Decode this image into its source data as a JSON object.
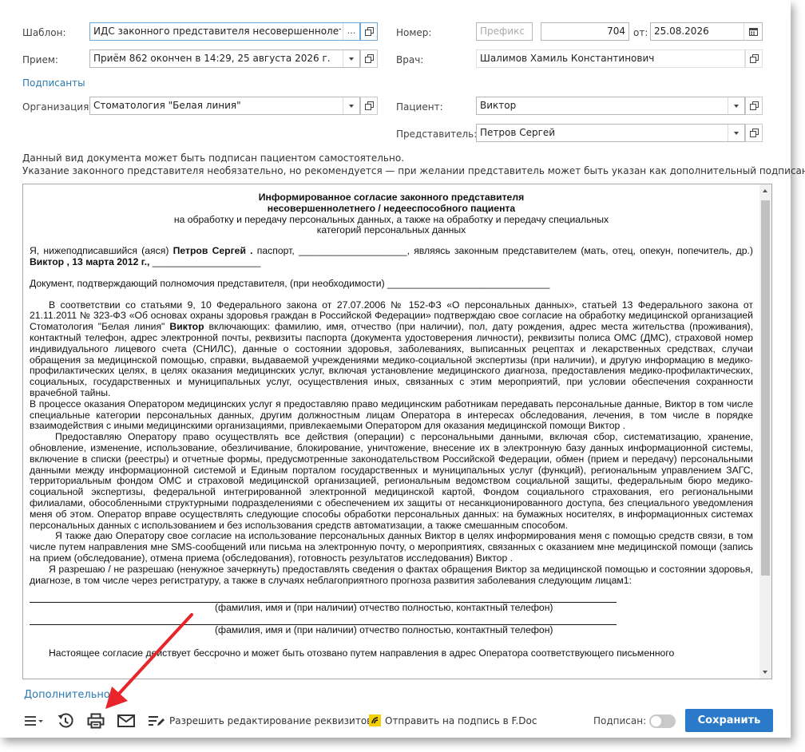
{
  "form": {
    "template_label": "Шаблон:",
    "template_value": "ИДС законного представителя несовершеннолетнег",
    "template_dots": "...",
    "number_label": "Номер:",
    "number_prefix_placeholder": "Префикс",
    "number_value": "704",
    "date_label": "от:",
    "date_value": "25.08.2026",
    "appointment_label": "Прием:",
    "appointment_value": "Приём 862 окончен в 14:29, 25 августа 2026 г.",
    "doctor_label": "Врач:",
    "doctor_value": "Шалимов Хамиль Константинович",
    "signers_link": "Подписанты",
    "organization_label": "Организация:",
    "organization_value": "Стоматология \"Белая линия\"",
    "patient_label": "Пациент:",
    "patient_value": "Виктор",
    "representative_label": "Представитель:",
    "representative_value": "Петров Сергей"
  },
  "info": {
    "line1": "Данный вид документа может быть подписан пациентом самостоятельно.",
    "line2": "Указание законного представителя необязательно, но рекомендуется — при желании представитель может быть указан как дополнительный подписант."
  },
  "document": {
    "title1": "Информированное согласие законного представителя",
    "title2": "несовершеннолетнего / недееспособного пациента",
    "subtitle1": "на обработку и передачу персональных данных, а также на обработку и передачу специальных",
    "subtitle2": "категорий персональных данных",
    "p1_a": "Я, нижеподписавшийся (аяся) ",
    "p1_name": "Петров Сергей .",
    "p1_b": " паспорт, ____________________, являясь законным представителем (мать, отец, опекун, попечитель, др.) ",
    "p1_patient": " Виктор , 13 марта 2012 г.,",
    "p1_c": " ____________________",
    "p2": "Документ, подтверждающий полномочия представителя, (при необходимости) ______________________________",
    "p3_a": "В соответствии со статьями 9, 10 Федерального закона от 27.07.2006 № 152-ФЗ «О персональных данных», статьей 13 Федерального закона от 21.11.2011 № 323-ФЗ «Об основах охраны здоровья граждан в Российской Федерации» подтверждаю свое согласие на обработку медицинской организацией Стоматология \"Белая линия\"   ",
    "p3_patient": "Виктор",
    "p3_b": "  включающих: фамилию, имя, отчество (при наличии), пол, дату рождения, адрес места жительства (проживания), контактный телефон, адрес электронной почты, реквизиты паспорта (документа удостоверения личности), реквизиты полиса ОМС (ДМС), страховой номер индивидуального лицевого счета (СНИЛС), данные о состоянии здоровья, заболеваниях, выписанных рецептах и лекарственных средствах, случаи обращения за медицинской помощью, справки, выдаваемой учреждениями медико-социальной экспертизы (при наличии), и другую информацию в медико- профилактических целях, в целях оказания медицинских услуг, включая установление медицинского диагноза, предоставления медико-профилактических, социальных, государственных и муниципальных услуг, осуществления иных, связанных с этим мероприятий, при условии обеспечения сохранности врачебной тайны.",
    "p4": "В процессе оказания Оператором медицинских услуг я предоставляю право медицинским работникам передавать персональные данные,  Виктор  в том числе специальные категории персональных данных, другим должностным лицам Оператора в интересах обследования, лечения, в том числе в порядке взаимодействия с иными медицинскими организациями, привлекаемыми Оператором для оказания медицинской помощи  Виктор .",
    "p5": "Предоставляю Оператору право осуществлять все действия (операции) с персональными данными, включая сбор, систематизацию, хранение, обновление, изменение, использование, обезличивание, блокирование, уничтожение, внесение их в электронную базу данных информационной системы, включение в списки (реестры) и отчетные формы, предусмотренные законодательством Российской Федерации, обмен (прием и передачу) персональными данными между информационной системой и Единым порталом государственных и муниципальных услуг (функций), региональным управлением ЗАГС, территориальным фондом ОМС и страховой медицинской организацией, региональным ведомством социальной защиты, федеральным бюро медико-социальной экспертизы, федеральной интегрированной электронной медицинской картой, Фондом социального страхования, его региональными филиалами, обособленными структурными подразделениями с обеспечением их защиты от несанкционированного доступа, без специального уведомления меня об этом. Оператор вправе осуществлять следующие способы обработки персональных данных: на бумажных носителях, в информационных системах персональных данных с использованием и без использования средств автоматизации, а также смешанным способом.",
    "p6": "Я также даю Оператору свое согласие на использование персональных данных  Виктор  в целях информирования меня с помощью средств связи, в том числе путем направления мне SMS-сообщений или письма на электронную почту, о мероприятиях, связанных с оказанием мне медицинской помощи (запись на прием (обследование), отмена приема (обследования), готовность результатов исследования)  Виктор .",
    "p7": "Я разрешаю / не разрешаю (ненужное зачеркнуть) предоставлять сведения о фактах обращения  Виктор  за медицинской помощью и состоянии здоровья, диагнозе, в том числе через регистратуру, а также в случаях неблагоприятного прогноза развития заболевания следующим лицам1:",
    "caption1": "(фамилия, имя и (при наличии) отчество полностью, контактный телефон)",
    "caption2": "(фамилия, имя и (при наличии) отчество полностью, контактный телефон)",
    "p8_partial": "Настоящее согласие действует бессрочно и может быть отозвано путем направления в адрес Оператора соответствующего письменного"
  },
  "more_link": "Дополнительно",
  "toolbar": {
    "allow_edit_label": "Разрешить редактирование реквизитов",
    "send_fdoc_label": "Отправить на подпись в F.Doc",
    "signed_label": "Подписан:",
    "signed": false,
    "save_label": "Сохранить"
  },
  "colors": {
    "accent": "#2b7ac9",
    "link": "#2a7ab0",
    "fdoc_logo_bg": "#f5d000",
    "annotation_arrow": "#e8252a"
  },
  "icons": [
    "menu-icon",
    "history-icon",
    "print-icon",
    "mail-icon",
    "edit-list-icon",
    "fdoc-logo-icon",
    "open-window-icon",
    "calendar-icon",
    "dropdown-arrow-icon"
  ]
}
